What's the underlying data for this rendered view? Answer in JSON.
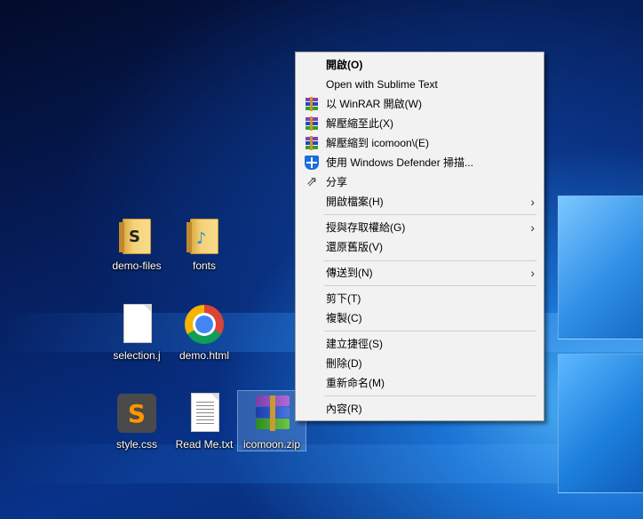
{
  "desktop": {
    "icons": [
      {
        "label": "demo-files"
      },
      {
        "label": "fonts"
      },
      {
        "label": "selection.j"
      },
      {
        "label": "demo.html"
      },
      {
        "label": "style.css"
      },
      {
        "label": "Read Me.txt"
      },
      {
        "label": "icomoon.zip"
      }
    ]
  },
  "context_menu": {
    "items": [
      {
        "label": "開啟(O)"
      },
      {
        "label": "Open with Sublime Text"
      },
      {
        "label": "以 WinRAR 開啟(W)"
      },
      {
        "label": "解壓縮至此(X)"
      },
      {
        "label": "解壓縮到 icomoon\\(E)"
      },
      {
        "label": "使用 Windows Defender 掃描..."
      },
      {
        "label": "分享"
      },
      {
        "label": "開啟檔案(H)"
      },
      {
        "label": "授與存取權給(G)"
      },
      {
        "label": "還原舊版(V)"
      },
      {
        "label": "傳送到(N)"
      },
      {
        "label": "剪下(T)"
      },
      {
        "label": "複製(C)"
      },
      {
        "label": "建立捷徑(S)"
      },
      {
        "label": "刪除(D)"
      },
      {
        "label": "重新命名(M)"
      },
      {
        "label": "內容(R)"
      }
    ],
    "submenu_arrow": "›"
  },
  "icons": {
    "folder": "folder-icon",
    "document": "document-icon",
    "browser": "chrome-icon",
    "editor": "sublime-text-icon",
    "archive": "winrar-archive-icon",
    "shield": "windows-defender-icon",
    "share": "share-icon"
  }
}
